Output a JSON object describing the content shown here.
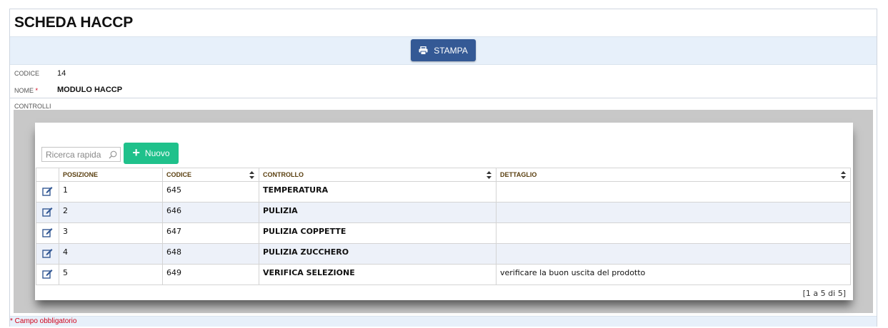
{
  "page": {
    "title": "SCHEDA HACCP"
  },
  "toolbar": {
    "print_label": "STAMPA",
    "print_icon": "printer-icon"
  },
  "fields": {
    "codice": {
      "label": "CODICE",
      "value": "14"
    },
    "nome": {
      "label": "NOME",
      "required_mark": "*",
      "value": "MODULO HACCP"
    }
  },
  "controls_section": {
    "label": "CONTROLLI"
  },
  "grid": {
    "search_placeholder": "Ricerca rapida",
    "new_label": "Nuovo",
    "columns": [
      "POSIZIONE",
      "CODICE",
      "CONTROLLO",
      "DETTAGLIO"
    ],
    "rows": [
      {
        "posizione": "1",
        "codice": "645",
        "controllo": "TEMPERATURA",
        "dettaglio": ""
      },
      {
        "posizione": "2",
        "codice": "646",
        "controllo": "PULIZIA",
        "dettaglio": ""
      },
      {
        "posizione": "3",
        "codice": "647",
        "controllo": "PULIZIA COPPETTE",
        "dettaglio": ""
      },
      {
        "posizione": "4",
        "codice": "648",
        "controllo": "PULIZIA ZUCCHERO",
        "dettaglio": ""
      },
      {
        "posizione": "5",
        "codice": "649",
        "controllo": "VERIFICA SELEZIONE",
        "dettaglio": "verificare la buon uscita del prodotto"
      }
    ],
    "pager": "[1 a 5 di 5]"
  },
  "footer": {
    "required_note": "* Campo obbligatorio"
  },
  "colors": {
    "print_button": "#345995",
    "new_button": "#1fc18b",
    "toolbar_bg": "#e7f0fa",
    "alt_row": "#edf1f9",
    "required": "#d0021b"
  }
}
